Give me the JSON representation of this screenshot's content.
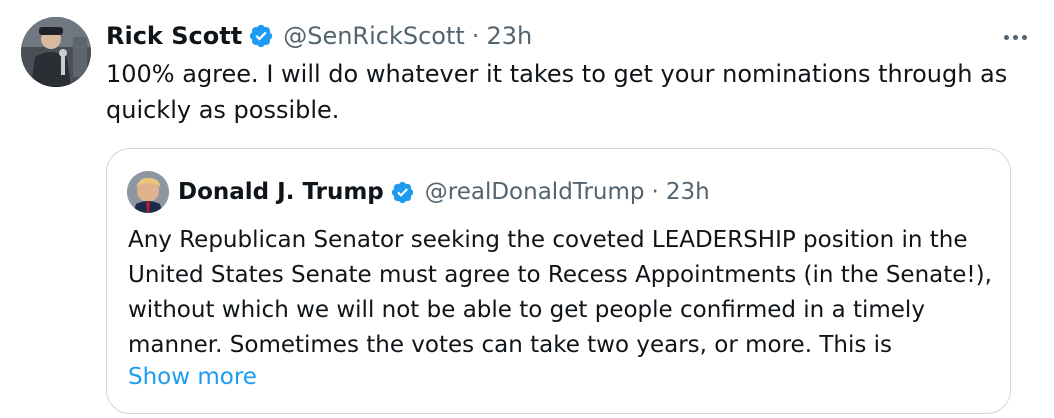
{
  "tweet": {
    "author_name": "Rick Scott",
    "author_handle": "@SenRickScott",
    "separator": "·",
    "time": "23h",
    "text": "100% agree. I will do whatever it takes to get your nominations through as quickly as possible.",
    "avatar_icon": "avatar-photo",
    "verified_icon": "verified-badge-icon",
    "more_icon": "more-options-icon"
  },
  "quote": {
    "author_name": "Donald J. Trump",
    "author_handle": "@realDonaldTrump",
    "separator": "·",
    "time": "23h",
    "text": "Any Republican Senator seeking the coveted LEADERSHIP position in the United States Senate must agree to Recess Appointments (in the Senate!), without which we will not be able to get people confirmed in a timely manner. Sometimes the votes can take two years, or more. This is",
    "show_more": "Show more"
  },
  "colors": {
    "text_primary": "#0f1419",
    "text_secondary": "#536471",
    "accent": "#1d9bf0",
    "border": "#cfd9de"
  }
}
